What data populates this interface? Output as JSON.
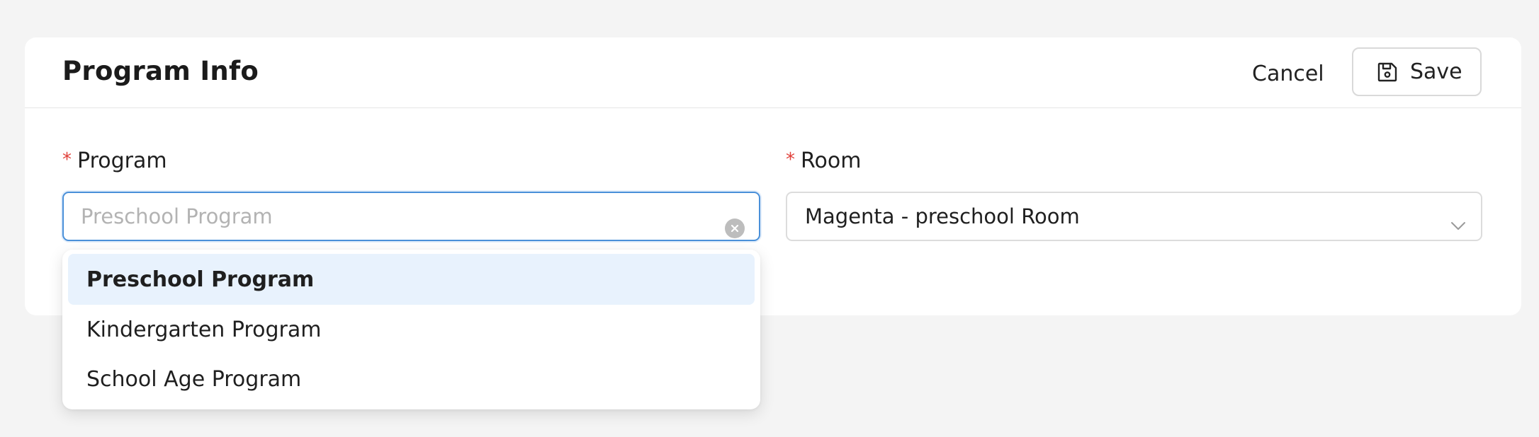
{
  "header": {
    "title": "Program Info",
    "cancel_label": "Cancel",
    "save_label": "Save"
  },
  "form": {
    "required_marker": "*",
    "program": {
      "label": "Program",
      "placeholder": "Preschool Program",
      "value": ""
    },
    "room": {
      "label": "Room",
      "value": "Magenta - preschool Room"
    }
  },
  "dropdown": {
    "options": [
      {
        "label": "Preschool Program",
        "selected": true
      },
      {
        "label": "Kindergarten Program",
        "selected": false
      },
      {
        "label": "School Age Program",
        "selected": false
      }
    ]
  },
  "colors": {
    "accent": "#4a90d9",
    "required": "#e0403a",
    "selected_option_bg": "#e8f2fd",
    "page_bg": "#f4f4f4"
  },
  "icons": {
    "save": "floppy-disk-icon",
    "clear": "clear-circle-icon",
    "room_dropdown": "chevron-down-icon"
  }
}
